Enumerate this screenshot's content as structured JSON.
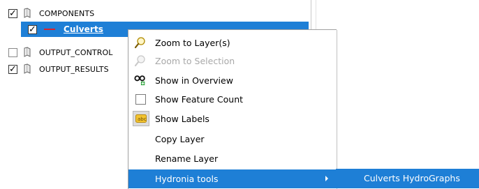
{
  "tree": {
    "rows": [
      {
        "label": "COMPONENTS",
        "checked": true
      },
      {
        "label": "Culverts",
        "checked": true
      },
      {
        "label": "OUTPUT_CONTROL",
        "checked": false
      },
      {
        "label": "OUTPUT_RESULTS",
        "checked": true
      }
    ]
  },
  "context_menu": {
    "items": [
      {
        "label": "Zoom to Layer(s)",
        "icon": "zoom-icon",
        "enabled": true
      },
      {
        "label": "Zoom to Selection",
        "icon": "zoom-icon",
        "enabled": false
      },
      {
        "label": "Show in Overview",
        "icon": "overview-icon",
        "enabled": true
      },
      {
        "label": "Show Feature Count",
        "icon": "checkbox-icon",
        "enabled": true
      },
      {
        "label": "Show Labels",
        "icon": "labels-icon",
        "enabled": true
      },
      {
        "label": "Copy Layer",
        "icon": "",
        "enabled": true
      },
      {
        "label": "Rename Layer",
        "icon": "",
        "enabled": true
      },
      {
        "label": "Hydronia tools",
        "icon": "",
        "enabled": true
      }
    ]
  },
  "submenu": {
    "items": [
      {
        "label": "Culverts HydroGraphs"
      }
    ]
  },
  "colors": {
    "selection": "#1e7fd6",
    "line_symbol": "#d9232b"
  }
}
